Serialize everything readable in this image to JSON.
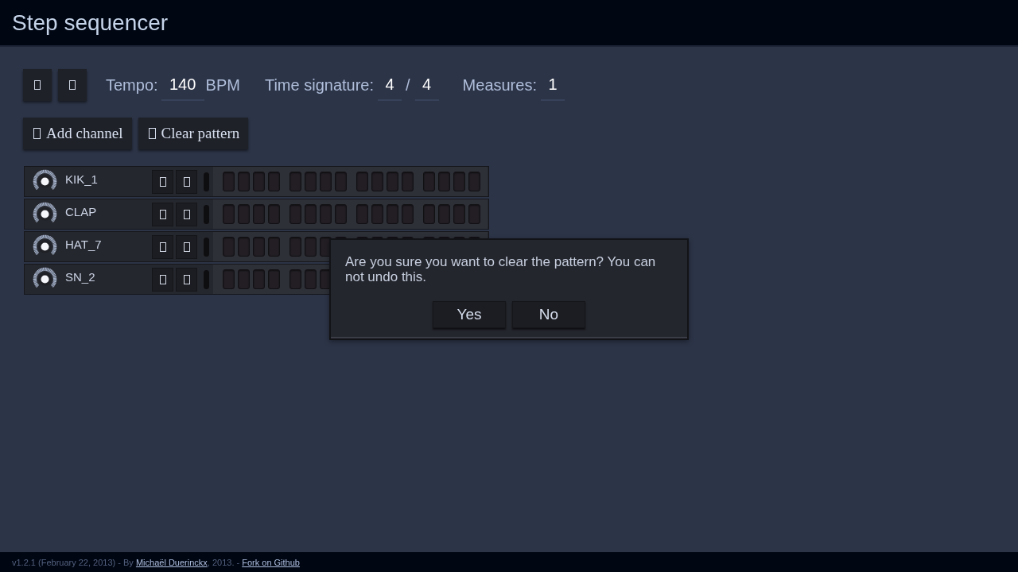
{
  "header": {
    "title": "Step sequencer"
  },
  "tempo": {
    "label": "Tempo:",
    "value": "140",
    "unit": "BPM"
  },
  "time_signature": {
    "label": "Time signature:",
    "beats": "4",
    "separator": "/",
    "note_value": "4"
  },
  "measures": {
    "label": "Measures:",
    "value": "1"
  },
  "actions": [
    {
      "label": "Add channel"
    },
    {
      "label": "Clear pattern"
    }
  ],
  "channels": [
    {
      "name": "KIK_1",
      "steps": [
        {
          "on": false
        },
        {
          "on": false
        },
        {
          "on": false
        },
        {
          "on": false
        },
        {
          "on": false
        },
        {
          "on": false
        },
        {
          "on": false
        },
        {
          "on": false
        },
        {
          "on": false
        },
        {
          "on": false
        },
        {
          "on": false
        },
        {
          "on": false
        },
        {
          "on": false
        },
        {
          "on": false
        },
        {
          "on": false
        },
        {
          "on": false
        }
      ]
    },
    {
      "name": "CLAP",
      "steps": [
        {
          "on": false
        },
        {
          "on": false
        },
        {
          "on": false
        },
        {
          "on": false
        },
        {
          "on": false
        },
        {
          "on": false
        },
        {
          "on": false
        },
        {
          "on": false
        },
        {
          "on": false
        },
        {
          "on": false
        },
        {
          "on": false
        },
        {
          "on": false
        },
        {
          "on": false
        },
        {
          "on": false
        },
        {
          "on": false
        },
        {
          "on": false
        }
      ]
    },
    {
      "name": "HAT_7",
      "steps": [
        {
          "on": false
        },
        {
          "on": false
        },
        {
          "on": false
        },
        {
          "on": false
        },
        {
          "on": false
        },
        {
          "on": false
        },
        {
          "on": false
        },
        {
          "on": false
        },
        {
          "on": false
        },
        {
          "on": false
        },
        {
          "on": false
        },
        {
          "on": false
        },
        {
          "on": false
        },
        {
          "on": false
        },
        {
          "on": false
        },
        {
          "on": false
        }
      ]
    },
    {
      "name": "SN_2",
      "steps": [
        {
          "on": false
        },
        {
          "on": false
        },
        {
          "on": false
        },
        {
          "on": false
        },
        {
          "on": false
        },
        {
          "on": false
        },
        {
          "on": false
        }
      ]
    }
  ],
  "dialog": {
    "message": "Are you sure you want to clear the pattern? You can not undo this.",
    "buttons": [
      "Yes",
      "No"
    ]
  },
  "footer": {
    "parts": [
      {
        "kind": "text",
        "text": "v1.2.1 (February 22, 2013) - By "
      },
      {
        "kind": "link",
        "text": "Michaël Duerinckx"
      },
      {
        "kind": "text",
        "text": ", 2013. - "
      },
      {
        "kind": "link",
        "text": "Fork on Github"
      }
    ]
  }
}
